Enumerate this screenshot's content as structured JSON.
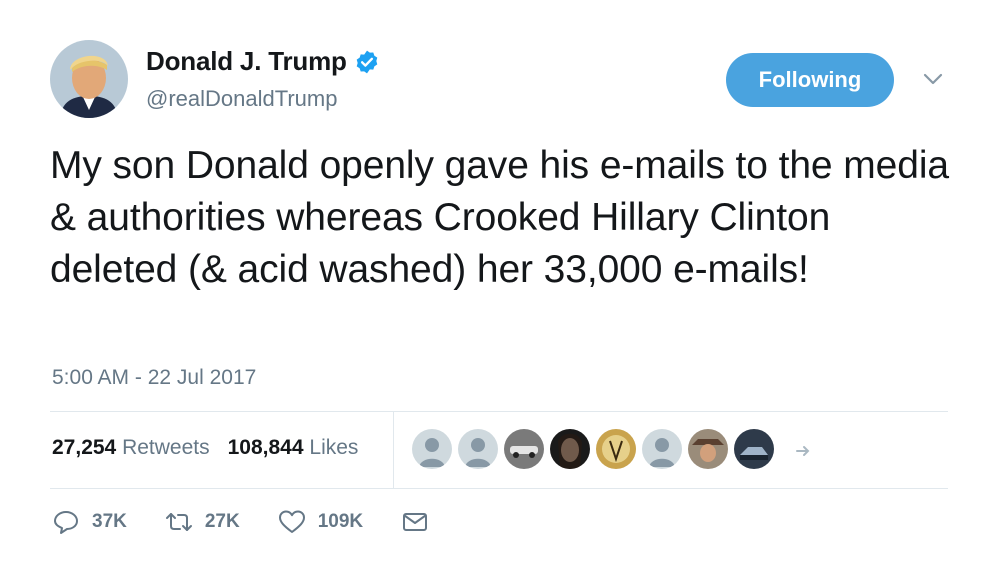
{
  "user": {
    "display_name": "Donald J. Trump",
    "handle": "@realDonaldTrump"
  },
  "follow_button": {
    "label": "Following"
  },
  "tweet": {
    "text": "My son Donald openly gave his e-mails to the media & authorities whereas Crooked Hillary Clinton deleted (& acid washed) her 33,000 e-mails!",
    "timestamp": "5:00 AM - 22 Jul 2017"
  },
  "stats": {
    "retweets_count": "27,254",
    "retweets_label": "Retweets",
    "likes_count": "108,844",
    "likes_label": "Likes"
  },
  "actions": {
    "reply_count": "37K",
    "retweet_count": "27K",
    "like_count": "109K"
  },
  "icons": {
    "verified": "verified-badge-icon",
    "caret": "chevron-down-icon",
    "reply": "reply-icon",
    "retweet": "retweet-icon",
    "like": "heart-icon",
    "message": "envelope-icon",
    "more_likers": "arrow-more-icon"
  },
  "colors": {
    "accent": "#4aa3df",
    "verified": "#1da1f2",
    "secondary_text": "#657786",
    "divider": "#e1e8ed"
  }
}
